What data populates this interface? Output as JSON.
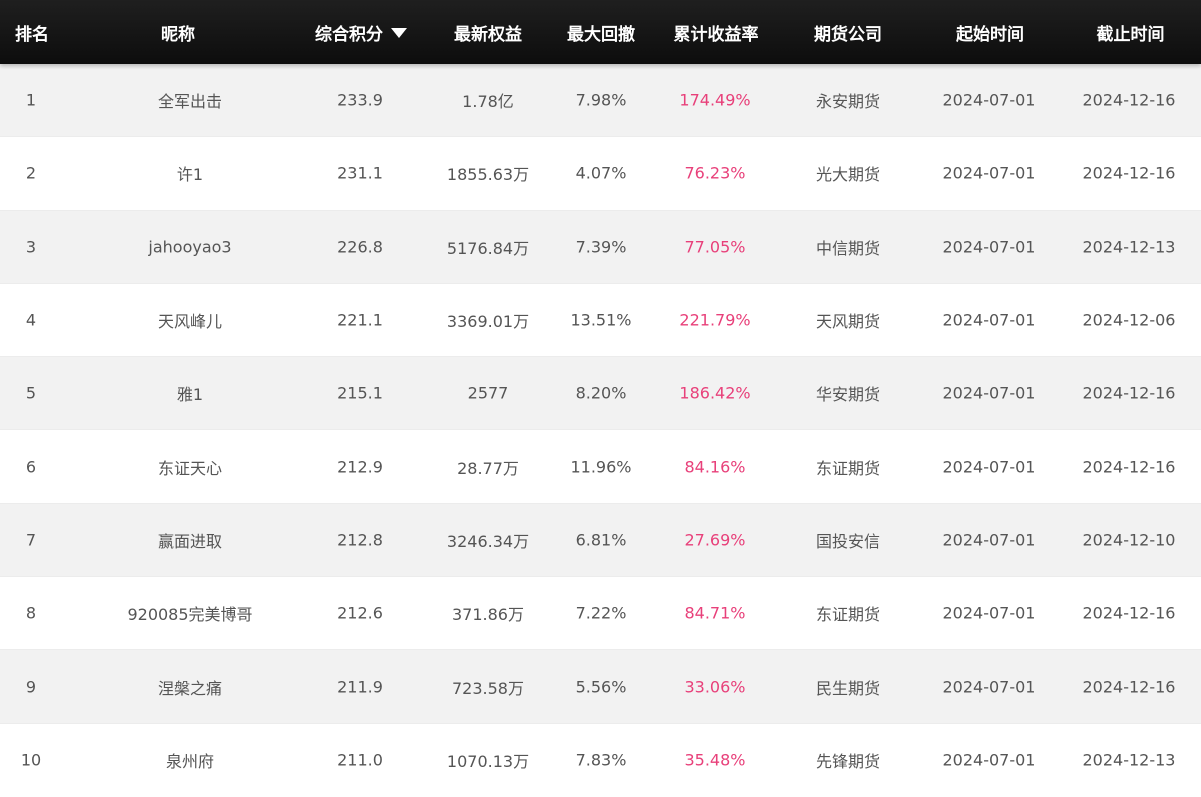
{
  "header": {
    "rank": "排名",
    "nickname": "昵称",
    "score": "综合积分",
    "equity": "最新权益",
    "max_drawdown": "最大回撤",
    "cum_return": "累计收益率",
    "company": "期货公司",
    "start": "起始时间",
    "end": "截止时间",
    "sort_icon": "sort-desc-icon"
  },
  "colors": {
    "header_bg": "#111111",
    "header_text": "#ffffff",
    "row_alt": "#f2f2f2",
    "return_color": "#e8407a",
    "body_text": "#555555"
  },
  "rows": [
    {
      "rank": "1",
      "nickname": "全军出击",
      "score": "233.9",
      "equity": "1.78亿",
      "max_drawdown": "7.98%",
      "cum_return": "174.49%",
      "company": "永安期货",
      "start": "2024-07-01",
      "end": "2024-12-16"
    },
    {
      "rank": "2",
      "nickname": "许1",
      "score": "231.1",
      "equity": "1855.63万",
      "max_drawdown": "4.07%",
      "cum_return": "76.23%",
      "company": "光大期货",
      "start": "2024-07-01",
      "end": "2024-12-16"
    },
    {
      "rank": "3",
      "nickname": "jahooyao3",
      "score": "226.8",
      "equity": "5176.84万",
      "max_drawdown": "7.39%",
      "cum_return": "77.05%",
      "company": "中信期货",
      "start": "2024-07-01",
      "end": "2024-12-13"
    },
    {
      "rank": "4",
      "nickname": "天风峰儿",
      "score": "221.1",
      "equity": "3369.01万",
      "max_drawdown": "13.51%",
      "cum_return": "221.79%",
      "company": "天风期货",
      "start": "2024-07-01",
      "end": "2024-12-06"
    },
    {
      "rank": "5",
      "nickname": "雅1",
      "score": "215.1",
      "equity": "2577",
      "max_drawdown": "8.20%",
      "cum_return": "186.42%",
      "company": "华安期货",
      "start": "2024-07-01",
      "end": "2024-12-16"
    },
    {
      "rank": "6",
      "nickname": "东证天心",
      "score": "212.9",
      "equity": "28.77万",
      "max_drawdown": "11.96%",
      "cum_return": "84.16%",
      "company": "东证期货",
      "start": "2024-07-01",
      "end": "2024-12-16"
    },
    {
      "rank": "7",
      "nickname": "赢面进取",
      "score": "212.8",
      "equity": "3246.34万",
      "max_drawdown": "6.81%",
      "cum_return": "27.69%",
      "company": "国投安信",
      "start": "2024-07-01",
      "end": "2024-12-10"
    },
    {
      "rank": "8",
      "nickname": "920085完美博哥",
      "score": "212.6",
      "equity": "371.86万",
      "max_drawdown": "7.22%",
      "cum_return": "84.71%",
      "company": "东证期货",
      "start": "2024-07-01",
      "end": "2024-12-16"
    },
    {
      "rank": "9",
      "nickname": "涅槃之痛",
      "score": "211.9",
      "equity": "723.58万",
      "max_drawdown": "5.56%",
      "cum_return": "33.06%",
      "company": "民生期货",
      "start": "2024-07-01",
      "end": "2024-12-16"
    },
    {
      "rank": "10",
      "nickname": "泉州府",
      "score": "211.0",
      "equity": "1070.13万",
      "max_drawdown": "7.83%",
      "cum_return": "35.48%",
      "company": "先锋期货",
      "start": "2024-07-01",
      "end": "2024-12-13"
    }
  ]
}
